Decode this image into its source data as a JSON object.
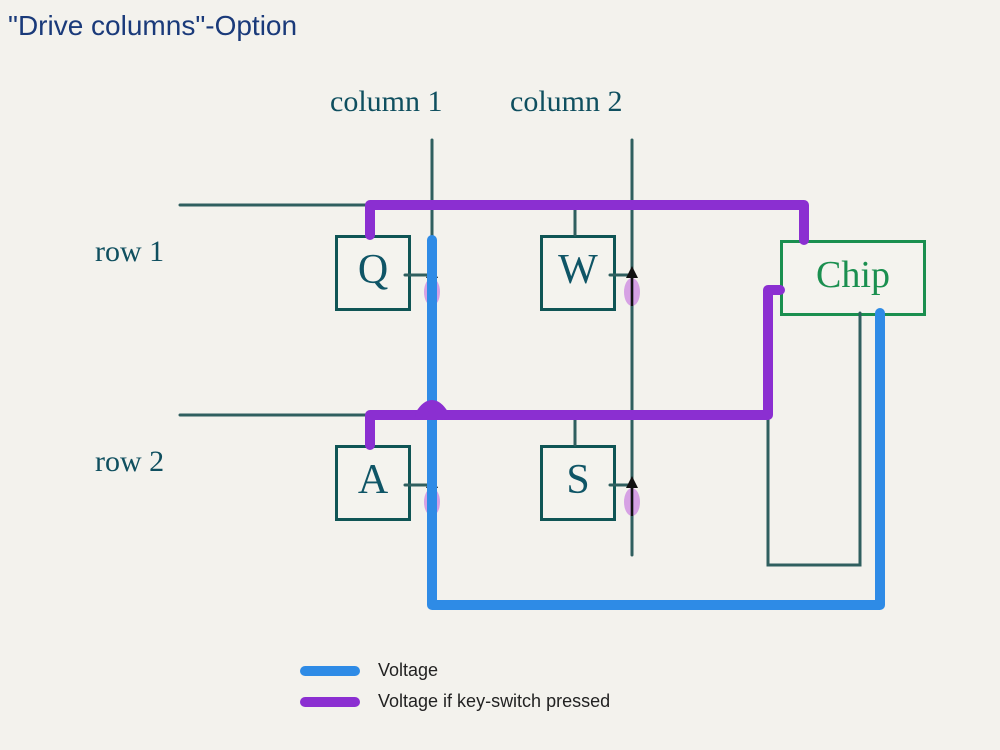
{
  "title": "\"Drive columns\"-Option",
  "labels": {
    "col1": "column 1",
    "col2": "column 2",
    "row1": "row 1",
    "row2": "row 2"
  },
  "keys": {
    "q": "Q",
    "w": "W",
    "a": "A",
    "s": "S"
  },
  "chip": "Chip",
  "legend": {
    "voltage": "Voltage",
    "voltage_pressed": "Voltage if key-switch pressed"
  },
  "colors": {
    "voltage": "#2e8be6",
    "voltage_pressed": "#8b2fd1",
    "pen": "#0f4f5f",
    "chip": "#1a8f4f",
    "diode_body": "#c97fe0"
  }
}
